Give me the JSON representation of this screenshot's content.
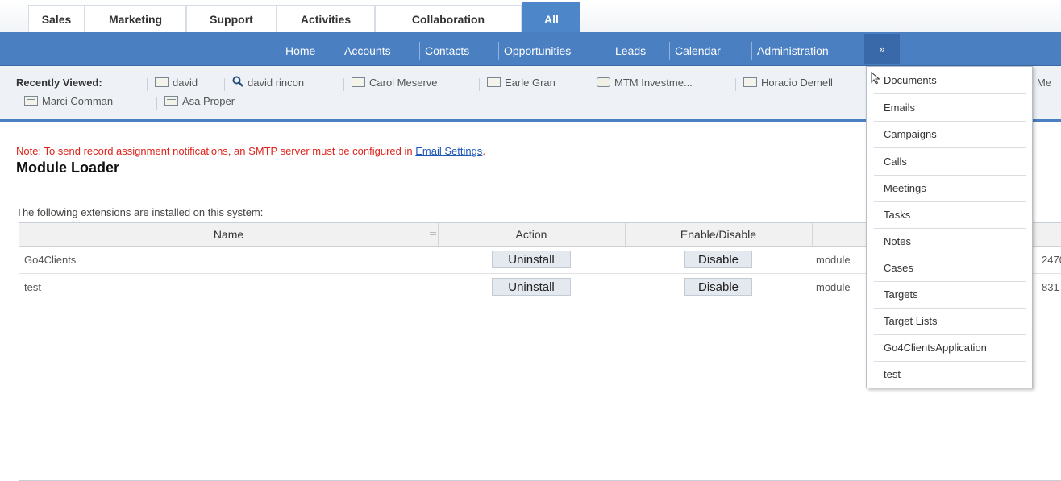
{
  "group_tabs": [
    "Sales",
    "Marketing",
    "Support",
    "Activities",
    "Collaboration",
    "All"
  ],
  "module_tabs": [
    "Home",
    "Accounts",
    "Contacts",
    "Opportunities",
    "Leads",
    "Calendar",
    "Administration"
  ],
  "more_tab_glyph": "»",
  "recently_viewed": {
    "label": "Recently Viewed:",
    "items": [
      "david",
      "david rincon",
      "Carol Meserve",
      "Earle Gran",
      "MTM Investme...",
      "Horacio Demell",
      "Me",
      "Marci Comman",
      "Asa Proper"
    ]
  },
  "note": {
    "text": "Note: To send record assignment notifications, an SMTP server must be configured in ",
    "link": "Email Settings",
    "suffix": "."
  },
  "page_title": "Module Loader",
  "intro": "The following extensions are installed on this system:",
  "table": {
    "columns": [
      "Name",
      "Action",
      "Enable/Disable"
    ],
    "rows": [
      {
        "name": "Go4Clients",
        "action": "Uninstall",
        "toggle": "Disable",
        "type": "module",
        "extra": "2470"
      },
      {
        "name": "test",
        "action": "Uninstall",
        "toggle": "Disable",
        "type": "module",
        "extra": "831"
      }
    ]
  },
  "dropdown": [
    "Documents",
    "Emails",
    "Campaigns",
    "Calls",
    "Meetings",
    "Tasks",
    "Notes",
    "Cases",
    "Targets",
    "Target Lists",
    "Go4ClientsApplication",
    "test"
  ],
  "colors": {
    "nav_blue": "#4a7fc1",
    "active_tab": "#4d86c9",
    "note_red": "#e0231b",
    "link_blue": "#1d57b7"
  }
}
